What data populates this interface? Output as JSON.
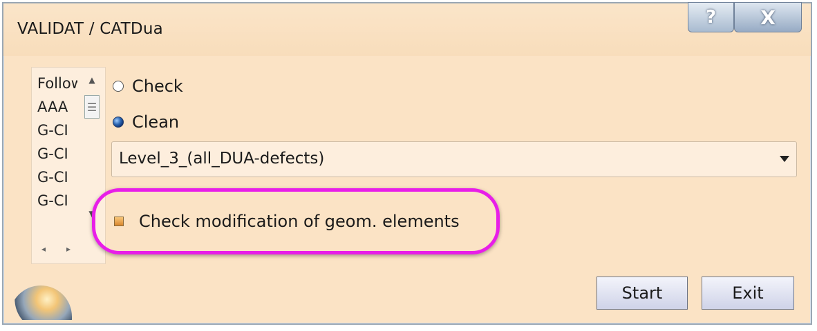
{
  "window": {
    "title": "VALIDAT / CATDua",
    "help_label": "?",
    "close_label": "X"
  },
  "list": {
    "items": [
      "Follow",
      "AAA",
      "G-CI",
      "G-CI",
      "G-CI",
      "G-CI"
    ],
    "thumb_glyph": "☰"
  },
  "options": {
    "check_label": "Check",
    "clean_label": "Clean",
    "selected": "Clean"
  },
  "level_select": {
    "value": "Level_3_(all_DUA-defects)"
  },
  "geom_check": {
    "label": "Check modification of geom. elements"
  },
  "buttons": {
    "start": "Start",
    "exit": "Exit"
  },
  "colors": {
    "background": "#fbe3c5",
    "highlight": "#e81ee8"
  }
}
